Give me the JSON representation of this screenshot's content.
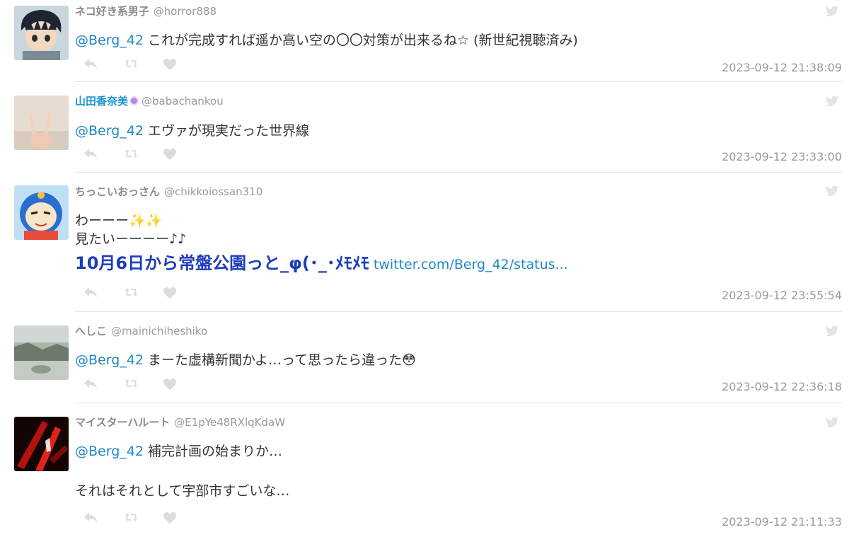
{
  "tweets": [
    {
      "display_name": "ネコ好き系男子",
      "handle": "@horror888",
      "mention": "@Berg_42",
      "text": " これが完成すれば遥か高い空の〇〇対策が出来るね☆ (新世紀視聴済み)",
      "timestamp": "2023-09-12 21:38:09"
    },
    {
      "display_name": "山田香奈美",
      "handle": "@babachankou",
      "mention": "@Berg_42",
      "text": " エヴァが現実だった世界線",
      "timestamp": "2023-09-12 23:33:00"
    },
    {
      "display_name": "ちっこいおっさん",
      "handle": "@chikkoiossan310",
      "line1": "わーーー✨✨",
      "line2": "見たいーーーー♪♪",
      "line3": "10月6日から常盤公園っと_φ(･_･ﾒﾓﾒﾓ",
      "link": "twitter.com/Berg_42/status...",
      "timestamp": "2023-09-12 23:55:54"
    },
    {
      "display_name": "へしこ",
      "handle": "@mainichiheshiko",
      "mention": "@Berg_42",
      "text": " まーた虚構新聞かよ…って思ったら違った😳",
      "timestamp": "2023-09-12 22:36:18"
    },
    {
      "display_name": "マイスターハルート",
      "handle": "@E1pYe48RXlqKdaW",
      "mention": "@Berg_42",
      "text": " 補完計画の始まりか…",
      "line2": "それはそれとして宇部市すごいな…",
      "timestamp": "2023-09-12 21:11:33"
    }
  ],
  "colors": {
    "mention": "#1e88c7",
    "name": "#8a8a8a",
    "action_icon": "#dcdcdc",
    "divider": "#e5e5e5"
  },
  "icons": [
    "reply-icon",
    "retweet-icon",
    "like-icon",
    "twitter-bird-icon"
  ]
}
